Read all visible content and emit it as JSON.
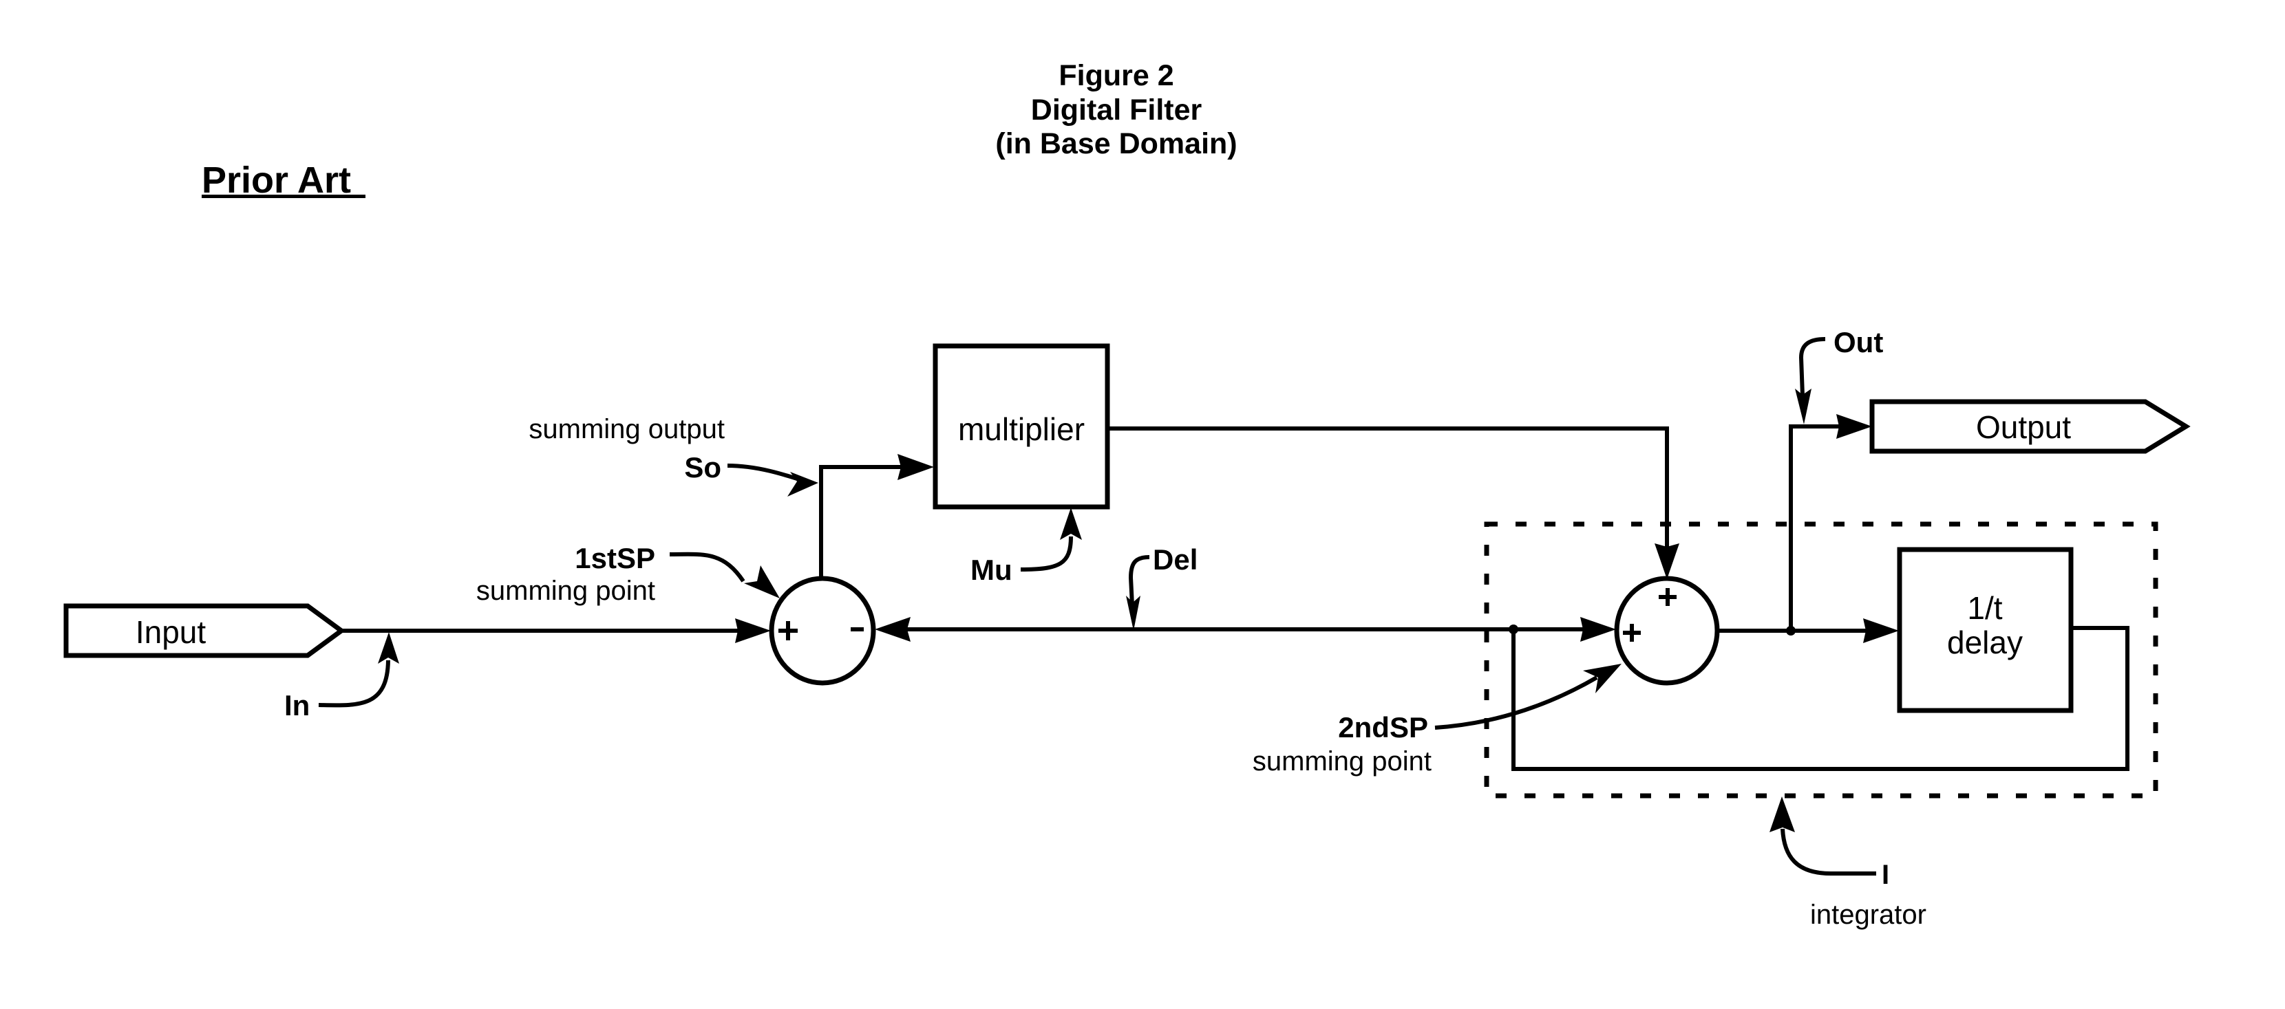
{
  "header": {
    "figure_label": "Figure 2",
    "title": "Digital Filter",
    "subtitle": "(in Base Domain)",
    "prior_art": "Prior Art"
  },
  "blocks": {
    "input": "Input",
    "output": "Output",
    "multiplier": "multiplier",
    "delay_line1": "1/t",
    "delay_line2": "delay"
  },
  "summing_points": {
    "first": {
      "plus": "+",
      "minus": "-"
    },
    "second": {
      "plus_top": "+",
      "plus_left": "+"
    }
  },
  "labels": {
    "in": "In",
    "so": "So",
    "so_desc": "summing output",
    "sp1": "1stSP",
    "sp1_desc": "summing  point",
    "mu": "Mu",
    "del": "Del",
    "sp2": "2ndSP",
    "sp2_desc": "summing  point",
    "out": "Out",
    "integrator_ref": "I",
    "integrator_desc": "integrator"
  }
}
